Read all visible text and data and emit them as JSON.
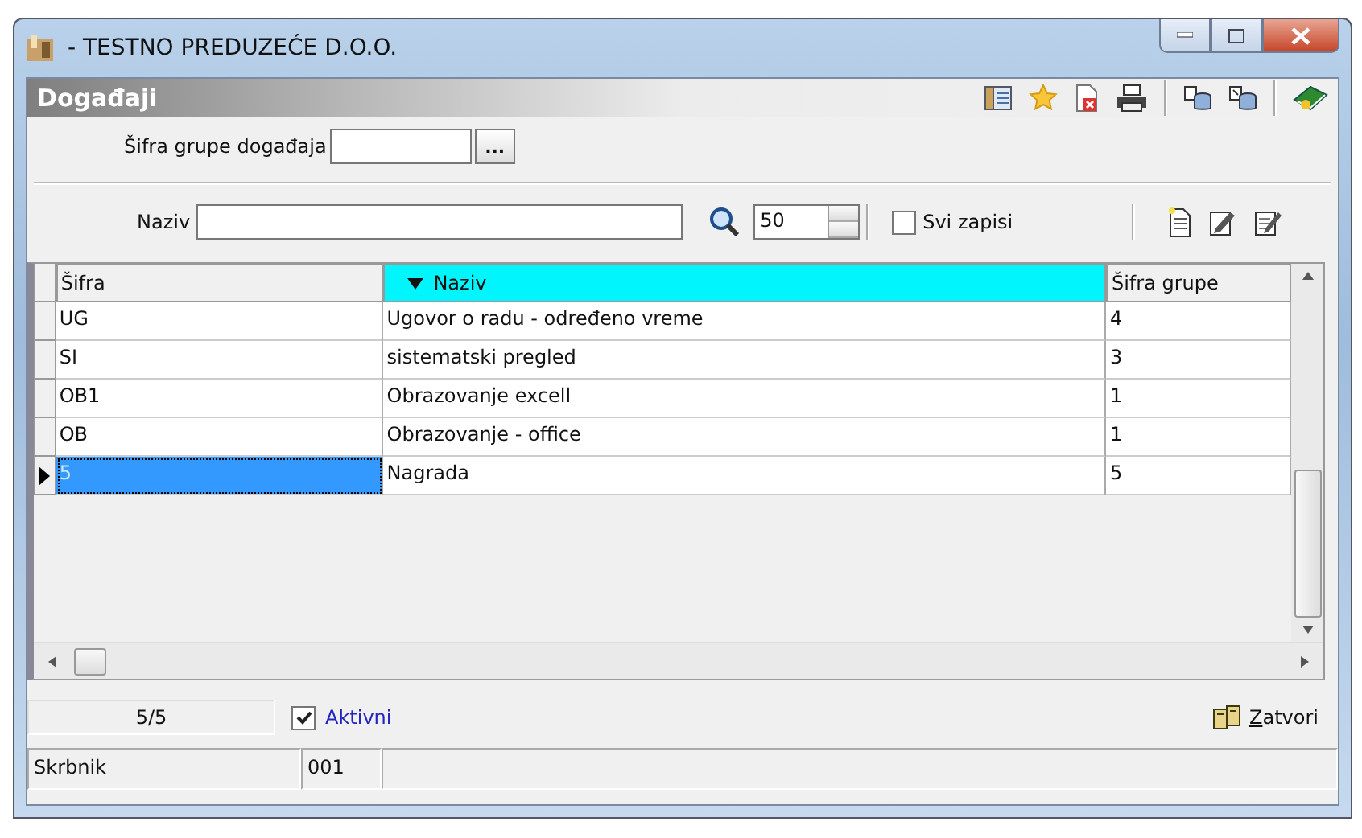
{
  "window": {
    "title": "- TESTNO PREDUZEĆE D.O.O."
  },
  "panel": {
    "title": "Događaji"
  },
  "filter": {
    "label": "Šifra grupe događaja",
    "browse_button": "..."
  },
  "search": {
    "label": "Naziv",
    "page_size": "50",
    "all_records": {
      "label": "Svi zapisi",
      "checked": false
    }
  },
  "table": {
    "columns": [
      {
        "label": "Šifra",
        "sorted": false
      },
      {
        "label": "Naziv",
        "sorted": true
      },
      {
        "label": "Šifra grupe",
        "sorted": false
      }
    ],
    "rows": [
      {
        "cells": [
          "UG",
          "Ugovor o radu - određeno vreme",
          "4"
        ],
        "selected": false
      },
      {
        "cells": [
          "SI",
          "sistematski pregled",
          "3"
        ],
        "selected": false
      },
      {
        "cells": [
          "OB1",
          "Obrazovanje excell",
          "1"
        ],
        "selected": false
      },
      {
        "cells": [
          "OB",
          "Obrazovanje - office",
          "1"
        ],
        "selected": false
      },
      {
        "cells": [
          "5",
          "Nagrada",
          "5"
        ],
        "selected": true
      }
    ]
  },
  "footer": {
    "count": "5/5",
    "active": {
      "label": "Aktivni",
      "checked": true
    },
    "close_button": "Zatvori"
  },
  "status_bar": [
    "Skrbnik",
    "001"
  ]
}
